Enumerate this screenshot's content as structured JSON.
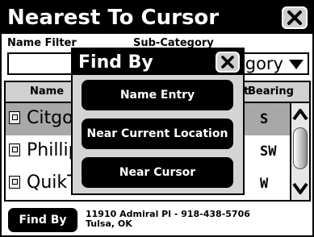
{
  "window": {
    "title": "Nearest To Cursor"
  },
  "filters": {
    "name_filter_label": "Name Filter",
    "name_filter_value": "",
    "subcategory_label": "Sub-Category",
    "subcategory_value": "Category"
  },
  "table": {
    "columns": {
      "name": "Name",
      "distance": "Distance",
      "bearing": "Bearing"
    },
    "rows": [
      {
        "name": "Citgo",
        "bearing": "S",
        "selected": true
      },
      {
        "name": "Phillips 66",
        "bearing": "SW",
        "selected": false
      },
      {
        "name": "QuikTrip",
        "bearing": "W",
        "selected": false
      }
    ]
  },
  "footer": {
    "findby_label": "Find By",
    "address_line1": "11910 Admiral Pl - 918-438-5706",
    "address_line2": "Tulsa, OK"
  },
  "dialog": {
    "title": "Find By",
    "buttons": {
      "name_entry": "Name Entry",
      "near_current_location": "Near Current Location",
      "near_cursor": "Near Cursor"
    }
  },
  "icons": {
    "title_close": "close-icon",
    "dialog_close": "close-icon",
    "dropdown": "chevron-down-icon",
    "row_icon": "poi-icon",
    "scroll_up": "chevron-up-icon",
    "scroll_down": "chevron-down-icon"
  },
  "colors": {
    "title_bar": "#000000",
    "selected_row": "#a8a8a8",
    "header_row": "#d0d0d0",
    "dialog_bg": "#d4d4d4",
    "button": "#000000"
  }
}
